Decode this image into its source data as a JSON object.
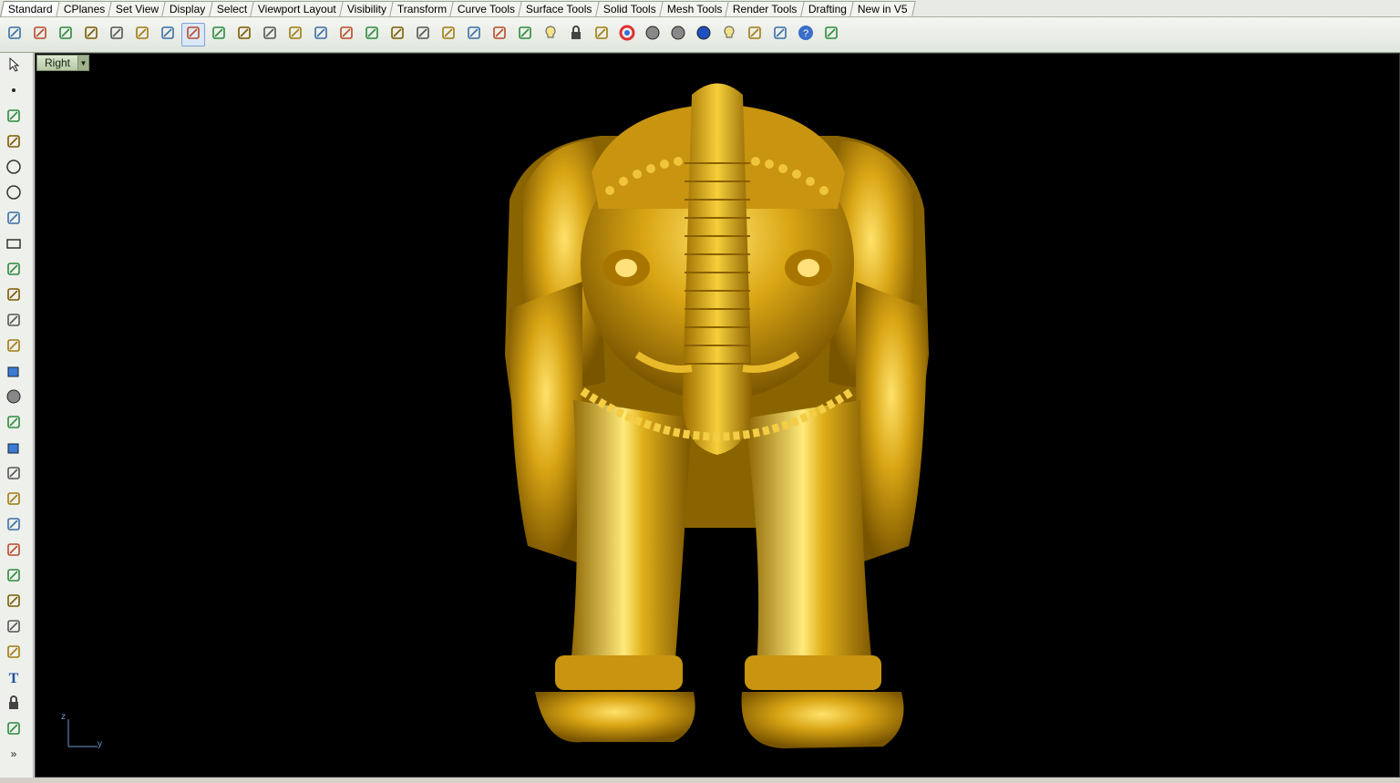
{
  "tabs": [
    {
      "label": "Standard",
      "active": true
    },
    {
      "label": "CPlanes"
    },
    {
      "label": "Set View"
    },
    {
      "label": "Display"
    },
    {
      "label": "Select"
    },
    {
      "label": "Viewport Layout"
    },
    {
      "label": "Visibility"
    },
    {
      "label": "Transform"
    },
    {
      "label": "Curve Tools"
    },
    {
      "label": "Surface Tools"
    },
    {
      "label": "Solid Tools"
    },
    {
      "label": "Mesh Tools"
    },
    {
      "label": "Render Tools"
    },
    {
      "label": "Drafting"
    },
    {
      "label": "New in V5"
    }
  ],
  "toolbar_icons": [
    "new-icon",
    "open-icon",
    "save-icon",
    "print-icon",
    "import-icon",
    "cut-icon",
    "copy-icon",
    "paste-icon",
    "undo-icon",
    "pan-icon",
    "rotate-view-icon",
    "zoom-icon",
    "zoom-window-icon",
    "zoom-extents-icon",
    "zoom-selected-icon",
    "undo-view-icon",
    "four-viewports-icon",
    "car-icon",
    "grid-car-icon",
    "cplane-icon",
    "snap-icon",
    "light-icon",
    "lock-icon",
    "layer-icon",
    "color-wheel-icon",
    "shade-icon",
    "ghost-icon",
    "render-icon",
    "spotlight-icon",
    "options-icon",
    "dimension-icon",
    "help-icon",
    "command-icon"
  ],
  "left_icons": [
    "select-arrow-icon",
    "point-icon",
    "polyline-icon",
    "curve-icon",
    "circle-icon",
    "ellipse-icon",
    "arc-icon",
    "rectangle-icon",
    "polygon-icon",
    "fillet-icon",
    "surface-icon",
    "loft-icon",
    "box-icon",
    "sphere-icon",
    "cylinder-icon",
    "mesh-icon",
    "transform-icon",
    "curve-from-object-icon",
    "dimension-tools-icon",
    "split-icon",
    "boolean-icon",
    "explode-icon",
    "edit-curve-icon",
    "rebuild-icon",
    "text-icon",
    "block-icon",
    "group-icon",
    "more-icon"
  ],
  "viewport": {
    "title": "Right",
    "axis_vertical": "z",
    "axis_horizontal": "y",
    "model_color": "#d4a017"
  }
}
